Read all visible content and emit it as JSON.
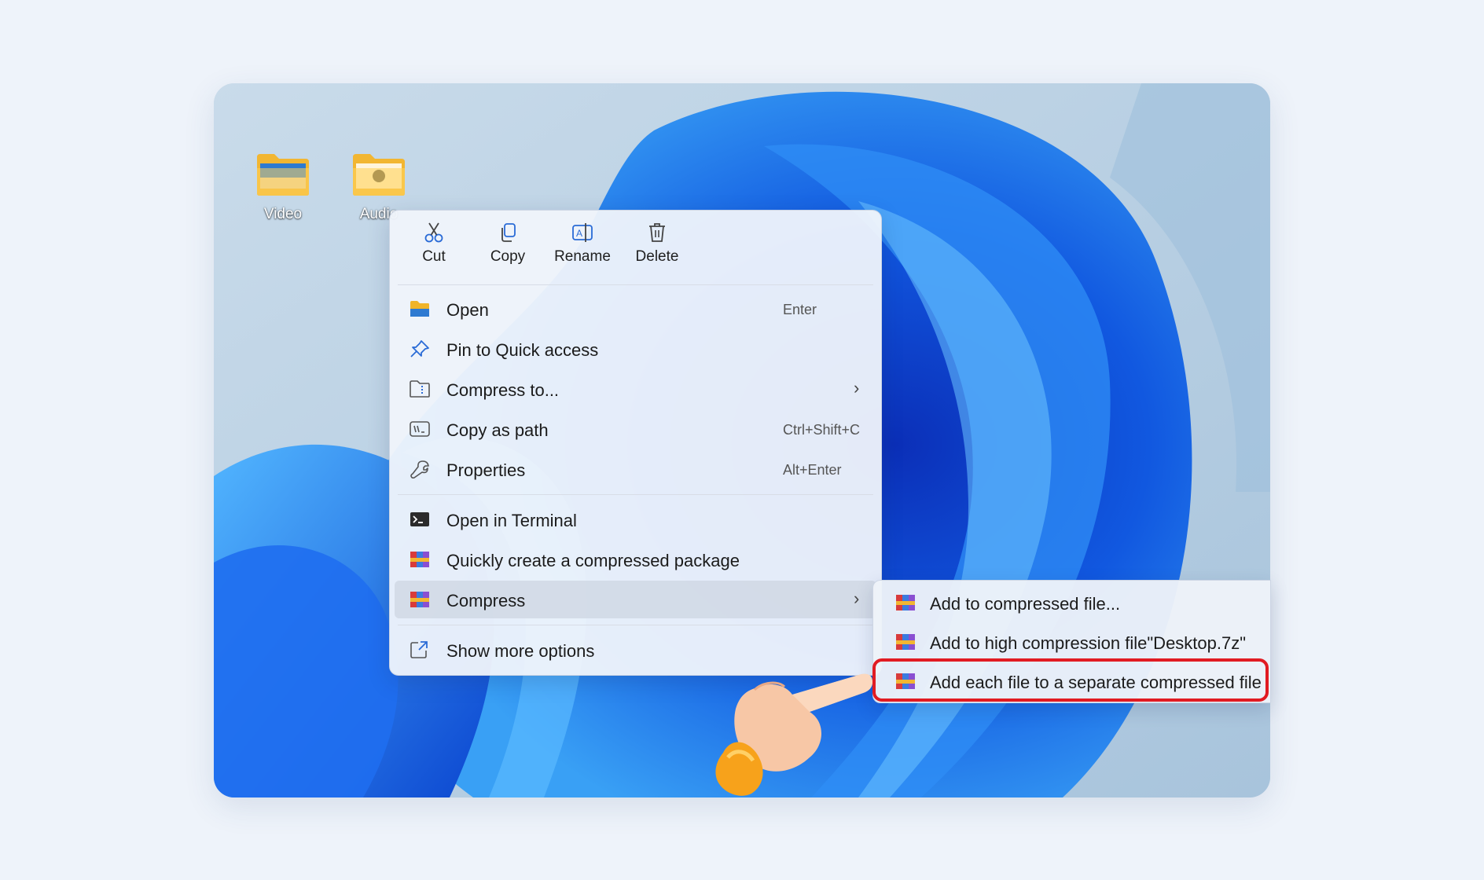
{
  "desktop": {
    "icons": [
      {
        "label": "Video",
        "icon": "video-folder-icon"
      },
      {
        "label": "Audio",
        "icon": "audio-folder-icon"
      }
    ]
  },
  "context_menu": {
    "toolbar": [
      {
        "label": "Cut",
        "icon": "scissors-icon"
      },
      {
        "label": "Copy",
        "icon": "copy-icon"
      },
      {
        "label": "Rename",
        "icon": "rename-icon"
      },
      {
        "label": "Delete",
        "icon": "trash-icon"
      }
    ],
    "items": [
      {
        "label": "Open",
        "shortcut": "Enter",
        "icon": "folder-icon"
      },
      {
        "label": "Pin to Quick access",
        "icon": "pin-icon"
      },
      {
        "label": "Compress to...",
        "icon": "zip-folder-icon",
        "has_submenu": true
      },
      {
        "label": "Copy as path",
        "shortcut": "Ctrl+Shift+C",
        "icon": "path-icon"
      },
      {
        "label": "Properties",
        "shortcut": "Alt+Enter",
        "icon": "wrench-icon"
      },
      {
        "label": "Open in Terminal",
        "icon": "terminal-icon"
      },
      {
        "label": "Quickly create a compressed package",
        "icon": "archive-icon"
      },
      {
        "label": "Compress",
        "icon": "archive-icon",
        "has_submenu": true,
        "highlighted": true
      },
      {
        "label": "Show more options",
        "icon": "external-icon"
      }
    ]
  },
  "submenu": {
    "items": [
      {
        "label": "Add to compressed file...",
        "icon": "archive-icon"
      },
      {
        "label": "Add to high compression file\"Desktop.7z\"",
        "icon": "archive-icon"
      },
      {
        "label": "Add each file to a separate compressed file",
        "icon": "archive-icon",
        "highlighted": true
      }
    ]
  },
  "colors": {
    "accent_ring": "#e11b22",
    "wallpaper_blue": "#1a5fe0",
    "menu_bg": "#f0f4fb"
  }
}
